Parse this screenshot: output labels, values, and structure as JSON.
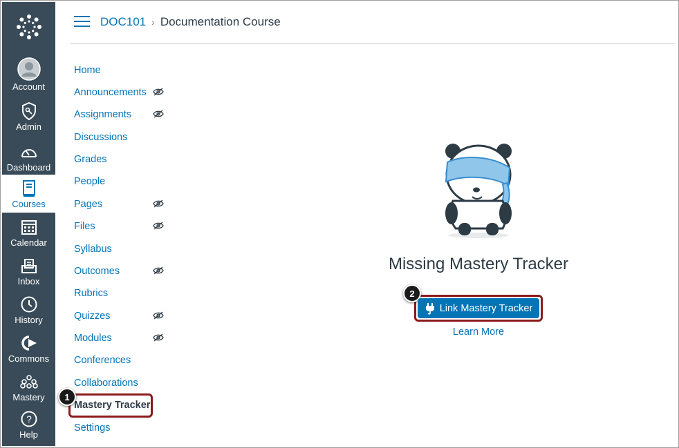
{
  "global_nav": {
    "items": [
      {
        "label": "Account",
        "icon": "account-avatar-icon"
      },
      {
        "label": "Admin",
        "icon": "admin-shield-icon"
      },
      {
        "label": "Dashboard",
        "icon": "dashboard-gauge-icon"
      },
      {
        "label": "Courses",
        "icon": "courses-book-icon",
        "active": true
      },
      {
        "label": "Calendar",
        "icon": "calendar-icon"
      },
      {
        "label": "Inbox",
        "icon": "inbox-icon"
      },
      {
        "label": "History",
        "icon": "history-clock-icon"
      },
      {
        "label": "Commons",
        "icon": "commons-arrow-icon"
      },
      {
        "label": "Mastery",
        "icon": "mastery-nodes-icon"
      },
      {
        "label": "Help",
        "icon": "help-question-icon"
      }
    ]
  },
  "header": {
    "course_code": "DOC101",
    "separator": "›",
    "course_name": "Documentation Course"
  },
  "course_nav": {
    "items": [
      {
        "label": "Home",
        "hidden": false
      },
      {
        "label": "Announcements",
        "hidden": true
      },
      {
        "label": "Assignments",
        "hidden": true
      },
      {
        "label": "Discussions",
        "hidden": false
      },
      {
        "label": "Grades",
        "hidden": false
      },
      {
        "label": "People",
        "hidden": false
      },
      {
        "label": "Pages",
        "hidden": true
      },
      {
        "label": "Files",
        "hidden": true
      },
      {
        "label": "Syllabus",
        "hidden": false
      },
      {
        "label": "Outcomes",
        "hidden": true
      },
      {
        "label": "Rubrics",
        "hidden": false
      },
      {
        "label": "Quizzes",
        "hidden": true
      },
      {
        "label": "Modules",
        "hidden": true
      },
      {
        "label": "Conferences",
        "hidden": false
      },
      {
        "label": "Collaborations",
        "hidden": false
      },
      {
        "label": "Mastery Tracker",
        "hidden": false,
        "active": true
      },
      {
        "label": "Settings",
        "hidden": false
      }
    ]
  },
  "main": {
    "title": "Missing Mastery Tracker",
    "link_button": "Link Mastery Tracker",
    "learn_more": "Learn More"
  },
  "callouts": {
    "one": "1",
    "two": "2"
  },
  "colors": {
    "nav_bg": "#394b58",
    "link": "#0374b5",
    "highlight": "#8b1a1a"
  }
}
